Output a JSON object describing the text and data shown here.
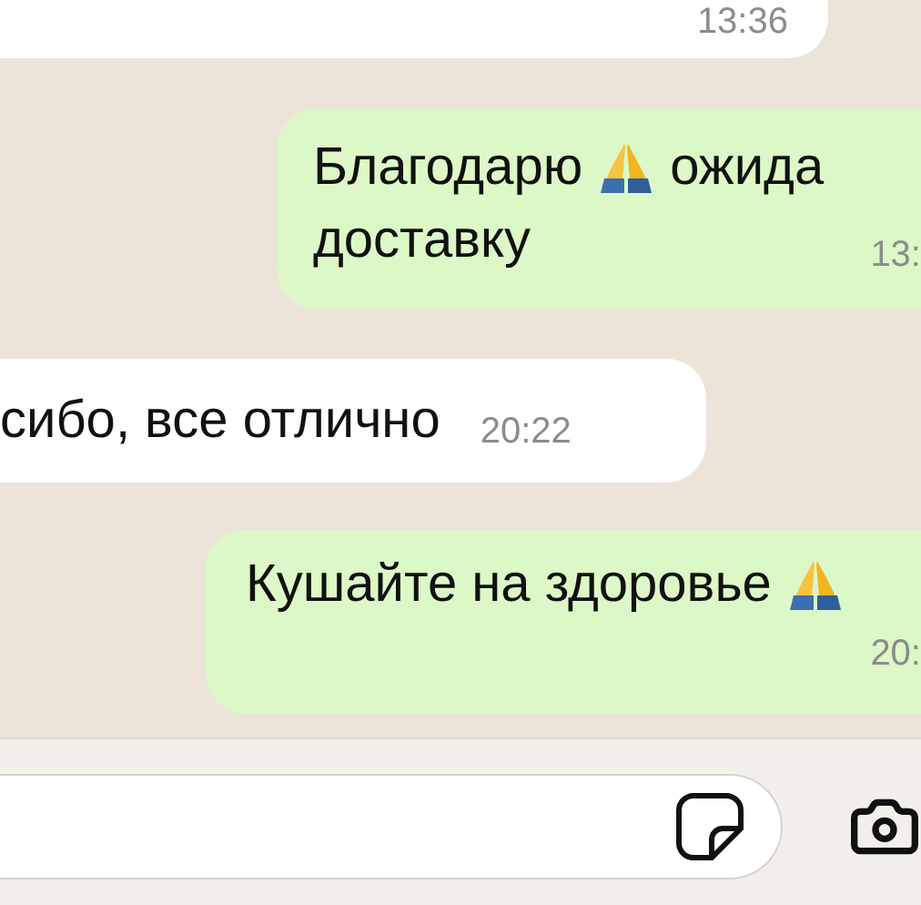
{
  "messages": [
    {
      "kind": "incoming",
      "time": "13:36"
    },
    {
      "kind": "outgoing",
      "lines": [
        [
          {
            "kind": "text",
            "text": "Благодарю"
          },
          {
            "kind": "emoji"
          },
          {
            "kind": "text",
            "text": "ожида"
          }
        ],
        [
          {
            "kind": "text",
            "text": "доставку"
          }
        ]
      ],
      "time": "13:"
    },
    {
      "kind": "incoming",
      "lines": [
        [
          {
            "kind": "text",
            "text": "сибо, все отлично"
          }
        ]
      ],
      "time": "20:22"
    },
    {
      "kind": "outgoing",
      "lines": [
        [
          {
            "kind": "text",
            "text": "Кушайте на здоровье"
          },
          {
            "kind": "emoji"
          }
        ]
      ],
      "time": "20:"
    }
  ]
}
